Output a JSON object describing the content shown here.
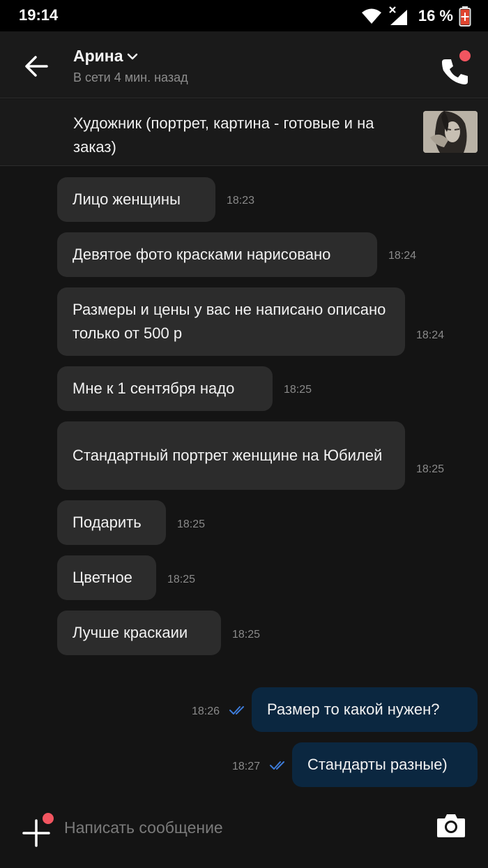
{
  "status_bar": {
    "time": "19:14",
    "battery": "16 %"
  },
  "header": {
    "contact_name": "Арина",
    "contact_status": "В сети 4 мин. назад"
  },
  "ad": {
    "title": "Художник (портрет, картина - готовые и на заказ)"
  },
  "messages": [
    {
      "direction": "in",
      "text": "Лицо женщины",
      "time": "18:23"
    },
    {
      "direction": "in",
      "text": "Девятое фото красками нарисовано",
      "time": "18:24"
    },
    {
      "direction": "in",
      "text": "Размеры и цены у вас не написано описано только от 500 р",
      "time": "18:24"
    },
    {
      "direction": "in",
      "text": "Мне к 1 сентября надо",
      "time": "18:25"
    },
    {
      "direction": "in",
      "text": "Стандартный портрет женщине на Юбилей",
      "time": "18:25"
    },
    {
      "direction": "in",
      "text": "Подарить",
      "time": "18:25"
    },
    {
      "direction": "in",
      "text": "Цветное",
      "time": "18:25"
    },
    {
      "direction": "in",
      "text": "Лучше краскаии",
      "time": "18:25"
    },
    {
      "direction": "out",
      "text": "Размер то какой нужен?",
      "time": "18:26",
      "read": true
    },
    {
      "direction": "out",
      "text": "Стандарты разные)",
      "time": "18:27",
      "read": true
    }
  ],
  "composer": {
    "placeholder": "Написать сообщение"
  },
  "colors": {
    "background": "#141414",
    "incoming_bubble": "#2c2c2c",
    "outgoing_bubble": "#0b2740",
    "notification_dot": "#f25560",
    "read_ticks": "#3d7bd8"
  }
}
